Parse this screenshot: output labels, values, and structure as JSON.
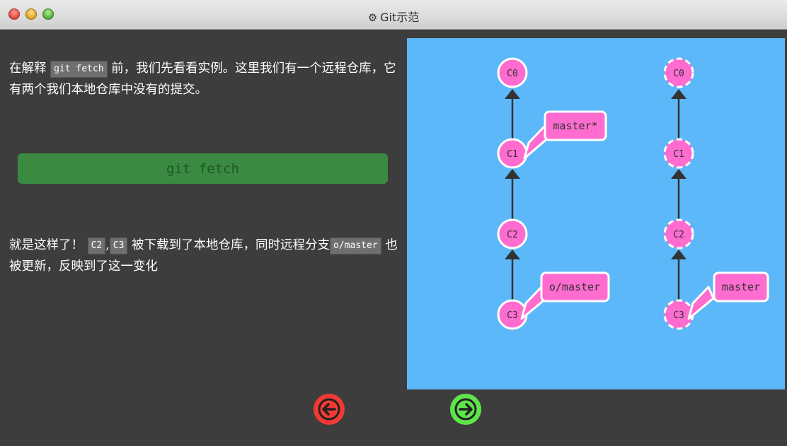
{
  "window": {
    "title": "Git示范"
  },
  "intro": {
    "before": "在解释 ",
    "code": "git fetch",
    "after": " 前，我们先看看实例。这里我们有一个远程仓库，它有两个我们本地仓库中没有的提交。"
  },
  "command_button": {
    "label": "git fetch"
  },
  "result": {
    "text1": "就是这样了！ ",
    "code1": "C2",
    "sep": ",",
    "code2": "C3",
    "text2": " 被下载到了本地仓库，同时远程分支",
    "code3": "o/master",
    "text3": " 也被更新，反映到了这一变化"
  },
  "graph": {
    "local_commits": [
      "C0",
      "C1",
      "C2",
      "C3"
    ],
    "remote_commits": [
      "C0",
      "C1",
      "C2",
      "C3"
    ],
    "local_branches": [
      "master*",
      "o/master"
    ],
    "remote_branches": [
      "master"
    ]
  },
  "colors": {
    "panel": "#5cb8f9",
    "node": "#ff6cd0",
    "button": "#3a8a41",
    "back": "#f23a34",
    "forward": "#5ee54b"
  }
}
